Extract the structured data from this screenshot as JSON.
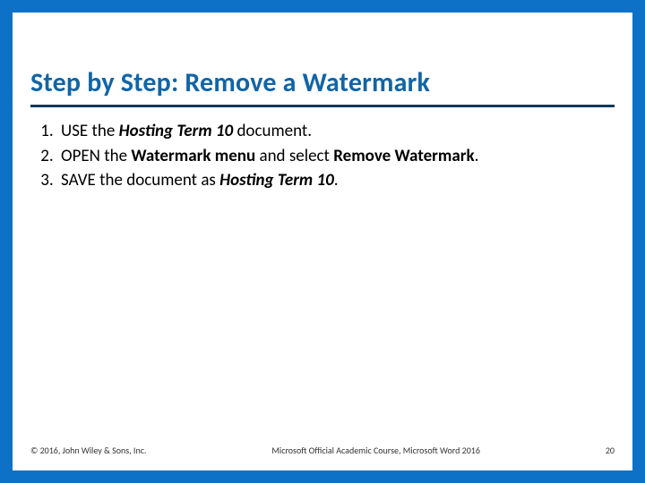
{
  "title": "Step by Step: Remove a Watermark",
  "steps": [
    {
      "pre": "USE the ",
      "emph": "Hosting Term 10",
      "mid": " document.",
      "emph2": "",
      "post": ""
    },
    {
      "pre": "OPEN the ",
      "emph": "Watermark menu",
      "mid": " and select ",
      "emph2": "Remove Watermark",
      "post": "."
    },
    {
      "pre": "SAVE the document as ",
      "emph": "Hosting Term 10",
      "mid": ".",
      "emph2": "",
      "post": ""
    }
  ],
  "footer": {
    "left": "© 2016, John Wiley & Sons, Inc.",
    "center": "Microsoft Official Academic Course, Microsoft Word 2016",
    "page": "20"
  }
}
